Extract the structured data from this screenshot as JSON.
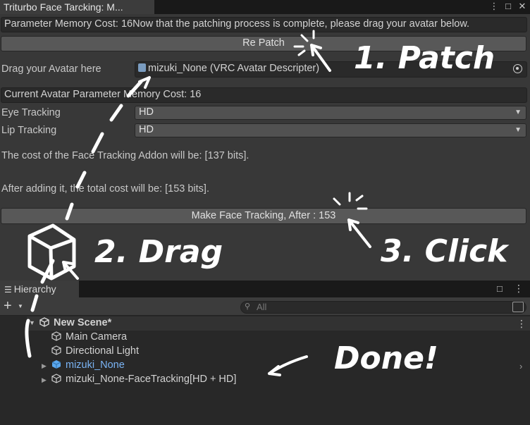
{
  "window": {
    "tab_title": "Triturbo Face Tarcking: M...",
    "icons": [
      "more-icon",
      "maximize-icon",
      "close-icon"
    ]
  },
  "inspector": {
    "status_text": "Parameter Memory Cost: 16Now that the patching process is complete, please drag your avatar below.",
    "repatch_label": "Re Patch",
    "avatar_field_label": "Drag your Avatar here",
    "avatar_field_value": "mizuki_None (VRC Avatar Descripter)",
    "current_cost_text": "Current Avatar Parameter Memory Cost: 16",
    "eye_tracking_label": "Eye Tracking",
    "eye_tracking_value": "HD",
    "lip_tracking_label": "Lip Tracking",
    "lip_tracking_value": "HD",
    "addon_cost_text": "The cost of the Face Tracking Addon will be: [137 bits].",
    "total_cost_text": "After adding it, the total cost will be: [153 bits].",
    "make_button_label": "Make Face Tracking, After : 153"
  },
  "hierarchy": {
    "tab_label": "Hierarchy",
    "search_placeholder": "All",
    "scene_name": "New Scene*",
    "items": [
      {
        "label": "Main Camera"
      },
      {
        "label": "Directional Light"
      },
      {
        "label": "mizuki_None"
      },
      {
        "label": "mizuki_None-FaceTracking[HD + HD]"
      }
    ]
  },
  "annotations": {
    "step1": "1. Patch",
    "step2": "2. Drag",
    "step3": "3. Click",
    "done": "Done!"
  },
  "colors": {
    "panel_bg": "#383838",
    "field_bg": "#2a2a2a",
    "button_bg": "#585858",
    "hierarchy_bg": "#282828",
    "prefab_blue": "#7ab4f5",
    "annotation": "#ffffff"
  }
}
